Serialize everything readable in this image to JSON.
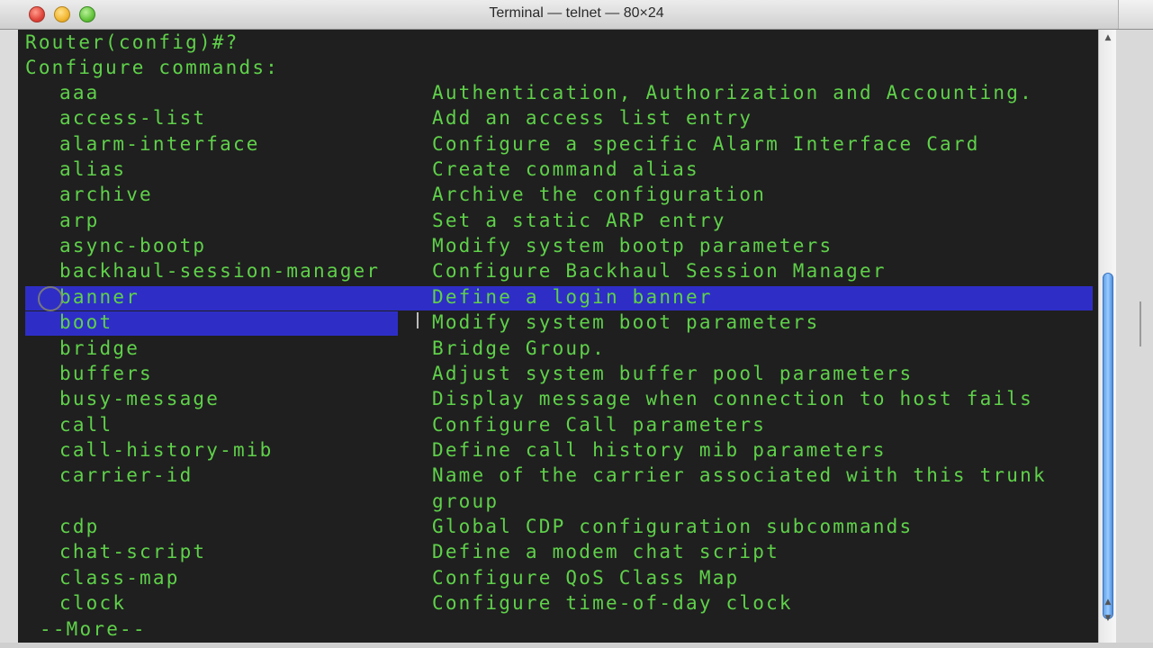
{
  "window": {
    "title": "Terminal — telnet — 80×24"
  },
  "terminal": {
    "prompt": "Router(config)#?",
    "header": "Configure commands:",
    "rows": [
      {
        "cmd": "aaa",
        "desc": "Authentication, Authorization and Accounting."
      },
      {
        "cmd": "access-list",
        "desc": "Add an access list entry"
      },
      {
        "cmd": "alarm-interface",
        "desc": "Configure a specific Alarm Interface Card"
      },
      {
        "cmd": "alias",
        "desc": "Create command alias"
      },
      {
        "cmd": "archive",
        "desc": "Archive the configuration"
      },
      {
        "cmd": "arp",
        "desc": "Set a static ARP entry"
      },
      {
        "cmd": "async-bootp",
        "desc": "Modify system bootp parameters"
      },
      {
        "cmd": "backhaul-session-manager",
        "desc": "Configure Backhaul Session Manager"
      },
      {
        "cmd": "banner",
        "desc": "Define a login banner"
      },
      {
        "cmd": "boot",
        "desc": "Modify system boot parameters"
      },
      {
        "cmd": "bridge",
        "desc": "Bridge Group."
      },
      {
        "cmd": "buffers",
        "desc": "Adjust system buffer pool parameters"
      },
      {
        "cmd": "busy-message",
        "desc": "Display message when connection to host fails"
      },
      {
        "cmd": "call",
        "desc": "Configure Call parameters"
      },
      {
        "cmd": "call-history-mib",
        "desc": "Define call history mib parameters"
      },
      {
        "cmd": "carrier-id",
        "desc": "Name of the carrier associated with this trunk"
      },
      {
        "cmd": "",
        "desc": "group"
      },
      {
        "cmd": "cdp",
        "desc": "Global CDP configuration subcommands"
      },
      {
        "cmd": "chat-script",
        "desc": "Define a modem chat script"
      },
      {
        "cmd": "class-map",
        "desc": "Configure QoS Class Map"
      },
      {
        "cmd": "clock",
        "desc": "Configure time-of-day clock"
      }
    ],
    "more": "--More--"
  },
  "scrollbar": {
    "up_icon": "triangle-up",
    "down_icon": "triangle-down",
    "position": 0.55
  },
  "colors": {
    "text": "#5fd14a",
    "background": "#1f1f1f",
    "selection": "#2e2ec7"
  }
}
